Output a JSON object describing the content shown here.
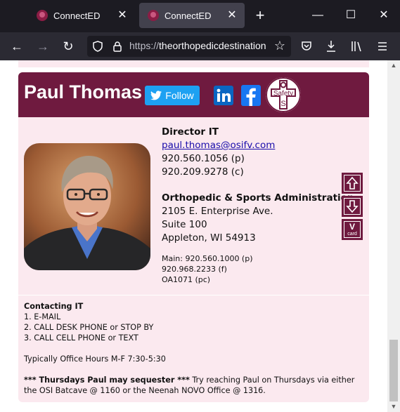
{
  "browser": {
    "tabs": [
      {
        "label": "ConnectED",
        "active": false
      },
      {
        "label": "ConnectED",
        "active": true
      }
    ],
    "url_scheme": "https://",
    "url_host": "theorthopedicdestination",
    "icons": [
      "back-icon",
      "forward-icon",
      "reload-icon",
      "shield-icon",
      "lock-icon",
      "bookmark-star-icon",
      "pocket-icon",
      "download-icon",
      "library-icon",
      "menu-icon"
    ]
  },
  "profile": {
    "name": "Paul Thomas",
    "follow_label": "Follow",
    "safety_label": "Safety",
    "title": "Director IT",
    "email": "paul.thomas@osifv.com",
    "phone_p": "920.560.1056 (p)",
    "phone_c": "920.209.9278 (c)",
    "org": "Orthopedic & Sports Administration",
    "address1": "2105 E. Enterprise Ave.",
    "address2": "Suite 100",
    "address3": "Appleton, WI 54913",
    "main": "Main: 920.560.1000 (p)",
    "fax": "920.968.2233 (f)",
    "pc": "OA1071 (pc)",
    "vcard_v": "V",
    "vcard_label": "card"
  },
  "notes": {
    "heading": "Contacting IT",
    "steps": [
      "1. E-MAIL",
      "2. CALL DESK PHONE or STOP BY",
      "3. CALL CELL PHONE or TEXT"
    ],
    "hours": "Typically Office Hours M-F 7:30-5:30",
    "thursday_bold": "*** Thursdays Paul may sequester ***",
    "thursday_rest": " Try reaching Paul on Thursdays via either",
    "thursday_line2": "the OSI Batcave @ 1160 or the Neenah NOVO Office @ 1316."
  },
  "colors": {
    "brand": "#6f1a3f",
    "card_bg": "#fbe9ef",
    "twitter": "#1da1f2",
    "linkedin": "#0a66c2",
    "facebook": "#1877f2",
    "link": "#1a0dab"
  }
}
